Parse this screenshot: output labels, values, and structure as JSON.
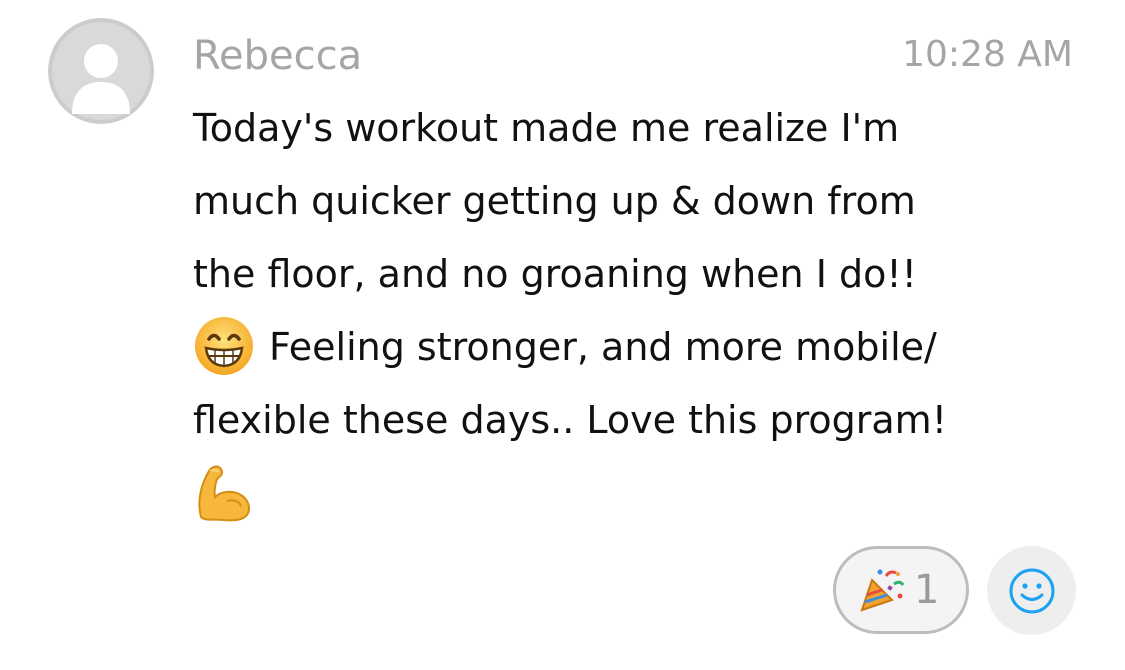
{
  "comment": {
    "author_name": "Rebecca",
    "timestamp": "10:28 AM",
    "avatar_icon": "default-user-avatar-icon",
    "message_lines": [
      "Today's workout made me realize I'm",
      "much quicker getting up & down from",
      "the floor, and no groaning when I do!!",
      "Feeling stronger, and more mobile/",
      "flexible these days.. Love this program!"
    ],
    "inline_emojis": [
      "grinning-face-with-smiling-eyes-emoji",
      "flexed-biceps-emoji"
    ]
  },
  "reactions": {
    "items": [
      {
        "icon": "party-popper-icon",
        "count": "1"
      }
    ],
    "add_reaction_icon": "smiley-face-icon"
  },
  "colors": {
    "secondary_text": "#a5a5a5",
    "body_text": "#111111",
    "accent_blue": "#1da1f2",
    "pill_border": "#bdbdbd"
  }
}
